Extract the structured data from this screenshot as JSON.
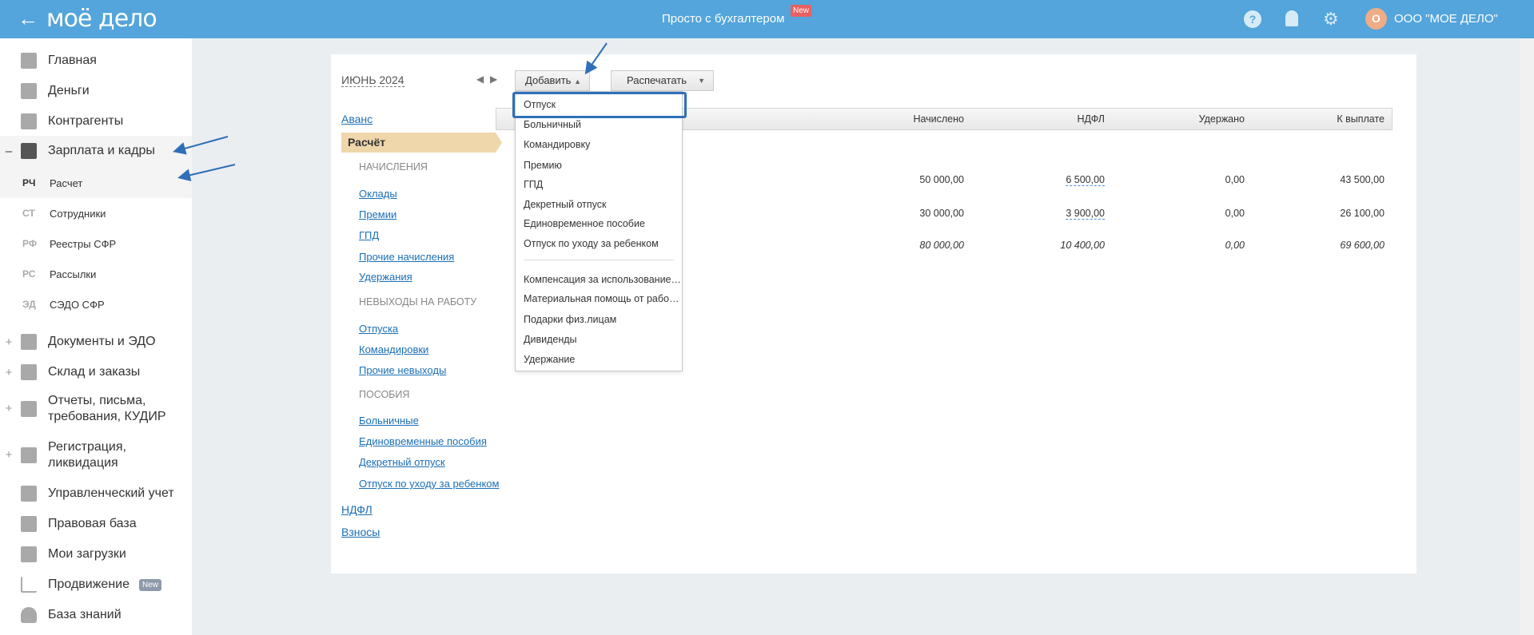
{
  "header": {
    "logo": "моё дело",
    "back": "←",
    "center": "Просто с бухгалтером",
    "new_badge": "New",
    "help": "?",
    "org_initial": "О",
    "org": "ООО \"МОЕ ДЕЛО\""
  },
  "sidebar": {
    "items": [
      {
        "label": "Главная",
        "icon": "home-icon"
      },
      {
        "label": "Деньги",
        "icon": "money-icon"
      },
      {
        "label": "Контрагенты",
        "icon": "contractors-icon"
      },
      {
        "label": "Зарплата и кадры",
        "icon": "wallet-icon",
        "expander": "–"
      }
    ],
    "sub": [
      {
        "abbr": "РЧ",
        "label": "Расчет"
      },
      {
        "abbr": "СТ",
        "label": "Сотрудники"
      },
      {
        "abbr": "РФ",
        "label": "Реестры СФР"
      },
      {
        "abbr": "РС",
        "label": "Рассылки"
      },
      {
        "abbr": "ЭД",
        "label": "СЭДО СФР"
      }
    ],
    "items2": [
      {
        "label": "Документы и ЭДО",
        "expander": "+"
      },
      {
        "label": "Склад и заказы",
        "expander": "+"
      },
      {
        "label": "Отчеты, письма, требования, КУДИР",
        "expander": "+"
      },
      {
        "label": "Регистрация, ликвидация",
        "expander": "+"
      },
      {
        "label": "Управленческий учет"
      },
      {
        "label": "Правовая база"
      },
      {
        "label": "Мои загрузки"
      },
      {
        "label": "Продвижение",
        "badge": "New"
      },
      {
        "label": "База знаний"
      }
    ]
  },
  "toolbar": {
    "month": "ИЮНЬ 2024",
    "add": "Добавить",
    "print": "Распечатать"
  },
  "nav": {
    "avans": "Аванс",
    "raschet": "Расчёт",
    "h1": "НАЧИСЛЕНИЯ",
    "l1": [
      "Оклады",
      "Премии",
      "ГПД",
      "Прочие начисления",
      "Удержания"
    ],
    "h2": "НЕВЫХОДЫ НА РАБОТУ",
    "l2": [
      "Отпуска",
      "Командировки",
      "Прочие невыходы"
    ],
    "h3": "ПОСОБИЯ",
    "l3": [
      "Больничные",
      "Единовременные пособия",
      "Декретный отпуск",
      "Отпуск по уходу за ребенком"
    ],
    "ndfl": "НДФЛ",
    "vznosy": "Взносы"
  },
  "dropdown": [
    "Отпуск",
    "Больничный",
    "Командировку",
    "Премию",
    "ГПД",
    "Декретный отпуск",
    "Единовременное пособие",
    "Отпуск по уходу за ребенком",
    "Компенсация за использование…",
    "Материальная помощь от рабо…",
    "Подарки физ.лицам",
    "Дивиденды",
    "Удержание"
  ],
  "table": {
    "headers": [
      "Начислено",
      "НДФЛ",
      "Удержано",
      "К выплате"
    ],
    "rows": [
      [
        "50 000,00",
        "6 500,00",
        "0,00",
        "43 500,00"
      ],
      [
        "30 000,00",
        "3 900,00",
        "0,00",
        "26 100,00"
      ]
    ],
    "total": [
      "80 000,00",
      "10 400,00",
      "0,00",
      "69 600,00"
    ]
  },
  "colors": {
    "header": "#53a5db",
    "accent": "#1b6fb5",
    "selected": "#efd6ab",
    "annotation": "#2f6fb8"
  }
}
